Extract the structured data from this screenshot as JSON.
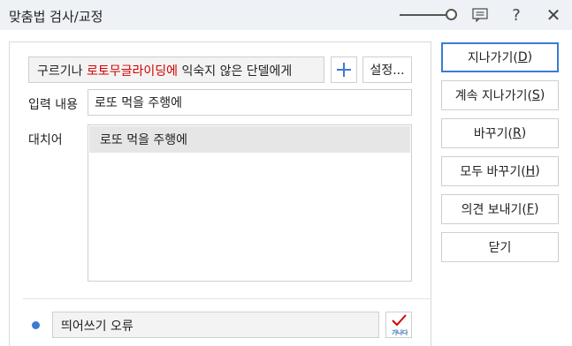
{
  "window": {
    "title": "맞춤법 검사/교정",
    "controls": {
      "comment_icon": "comment-icon",
      "help_symbol": "?",
      "close_symbol": "✕"
    }
  },
  "context": {
    "before": "구르기나 ",
    "highlight": "로토무글라이딩에",
    "after": " 익숙지 않은 단델에게",
    "highlight_color": "#d40000"
  },
  "toolbar": {
    "add_icon": "plus-icon",
    "settings_label": "설정..."
  },
  "input": {
    "label": "입력 내용",
    "value": "로또 먹을 주행에"
  },
  "alternatives": {
    "label": "대치어",
    "items": [
      "로또 먹을 주행에"
    ]
  },
  "error": {
    "type": "띄어쓰기 오류",
    "spell_icon_text": "가나다"
  },
  "buttons": [
    {
      "prefix": "지나가기(",
      "mnemonic": "D",
      "suffix": ")",
      "primary": true
    },
    {
      "prefix": "계속 지나가기(",
      "mnemonic": "S",
      "suffix": ")"
    },
    {
      "prefix": "바꾸기(",
      "mnemonic": "R",
      "suffix": ")"
    },
    {
      "prefix": "모두 바꾸기(",
      "mnemonic": "H",
      "suffix": ")"
    },
    {
      "prefix": "의견 보내기(",
      "mnemonic": "F",
      "suffix": ")"
    },
    {
      "prefix": "닫기",
      "mnemonic": "",
      "suffix": ""
    }
  ],
  "colors": {
    "accent": "#3a7bd5",
    "titlebar": "#eef1f6"
  }
}
